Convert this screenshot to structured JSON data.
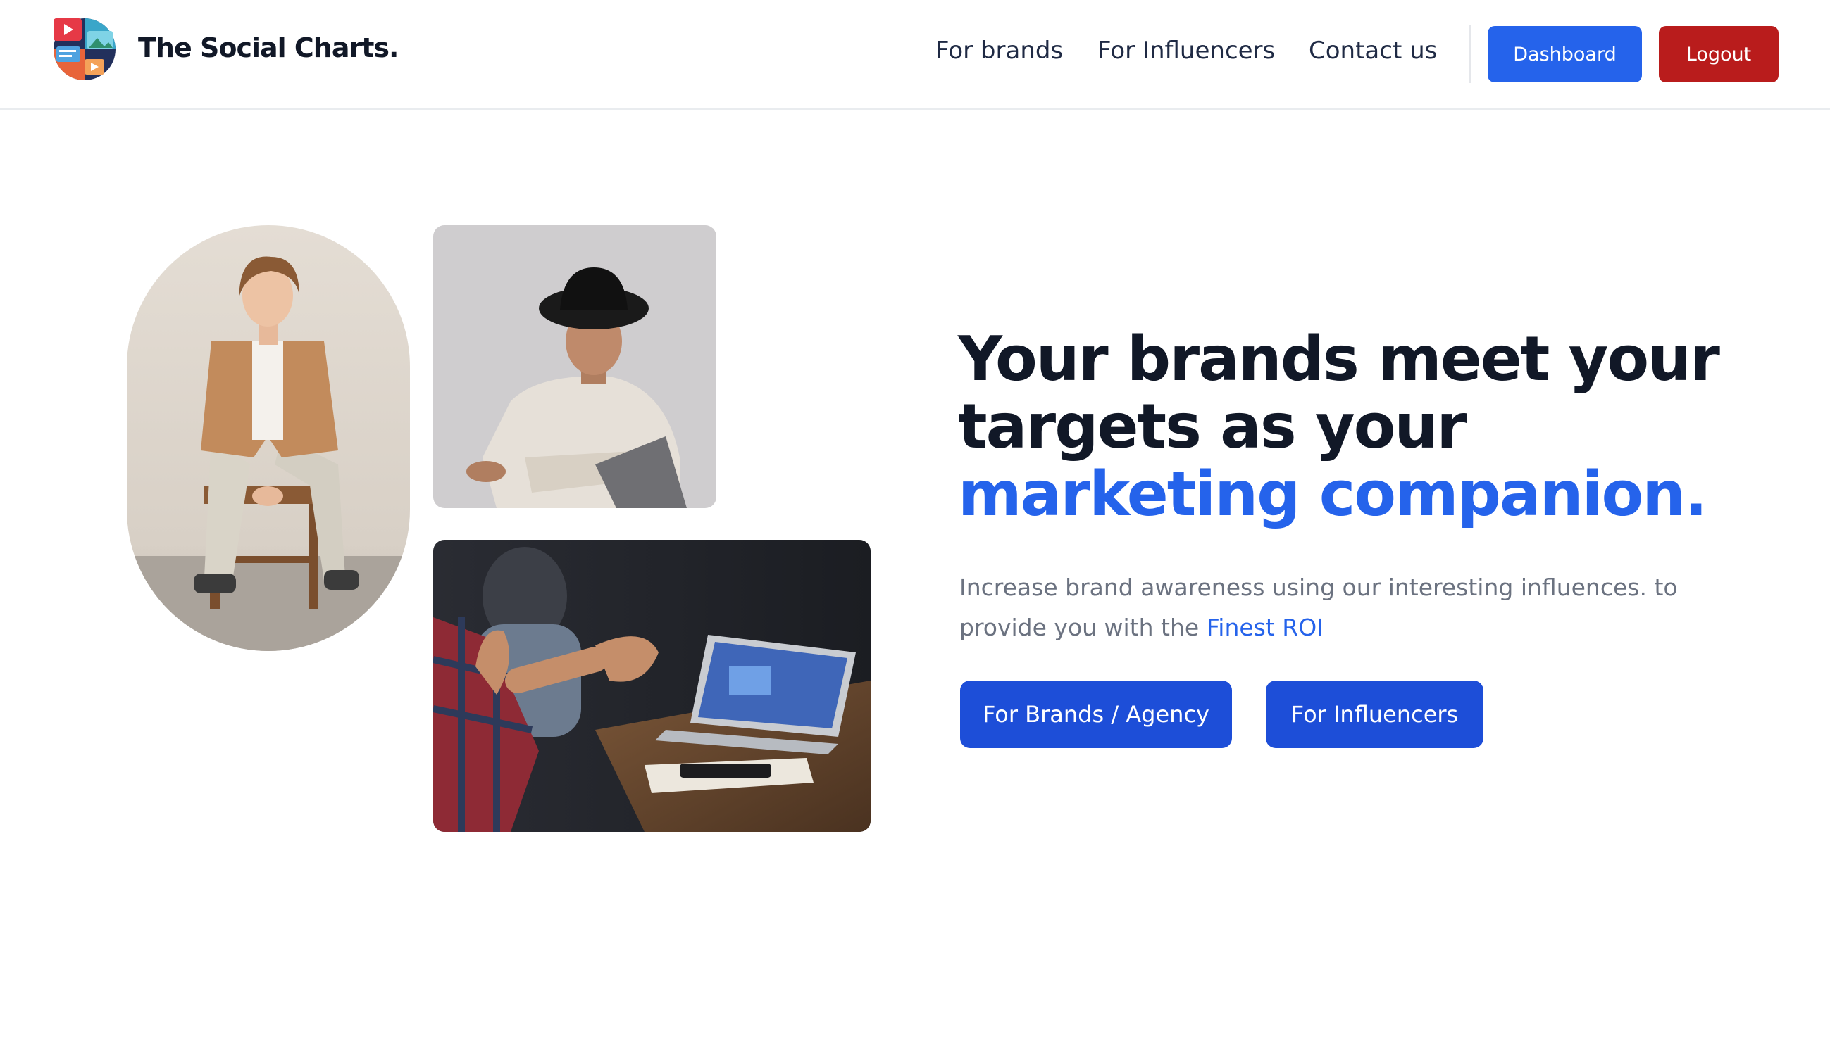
{
  "header": {
    "brand_name": "The Social Charts.",
    "logo_icon": "social-media-collage-logo",
    "nav": [
      {
        "label": "For brands"
      },
      {
        "label": "For Influencers"
      },
      {
        "label": "Contact us"
      }
    ],
    "dashboard_label": "Dashboard",
    "logout_label": "Logout"
  },
  "hero": {
    "headline_line1": "Your brands meet your",
    "headline_line2": "targets as your",
    "headline_accent": "marketing companion.",
    "subtext_main": "Increase brand awareness using our interesting influences. to provide you with the ",
    "subtext_highlight": "Finest ROI",
    "cta_brands": "For Brands / Agency",
    "cta_influencers": "For Influencers"
  },
  "images": [
    {
      "name": "man-seated-on-stool-photo"
    },
    {
      "name": "man-in-black-hat-photo"
    },
    {
      "name": "meeting-with-laptop-photo"
    }
  ],
  "colors": {
    "accent_blue": "#2563eb",
    "cta_blue": "#1d4ed8",
    "logout_red": "#b91c1c",
    "heading_dark": "#111827",
    "muted_text": "#6b7280"
  }
}
